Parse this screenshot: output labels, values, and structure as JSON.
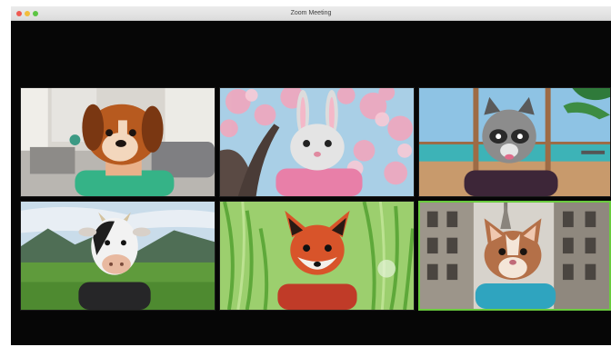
{
  "window": {
    "title": "Zoom Meeting",
    "controls": [
      "close",
      "minimize",
      "zoom"
    ]
  },
  "participants": [
    {
      "avatar": "dog",
      "background": "living-room",
      "speaking": false
    },
    {
      "avatar": "bunny",
      "background": "cherry-blossoms",
      "speaking": false
    },
    {
      "avatar": "raccoon",
      "background": "beach-balcony",
      "speaking": false
    },
    {
      "avatar": "cow",
      "background": "mountain-meadow",
      "speaking": false
    },
    {
      "avatar": "fox",
      "background": "tall-grass",
      "speaking": false
    },
    {
      "avatar": "cat",
      "background": "city-street",
      "speaking": true
    }
  ],
  "colors": {
    "active_speaker_border": "#6acb3e",
    "window_background": "#060606"
  }
}
